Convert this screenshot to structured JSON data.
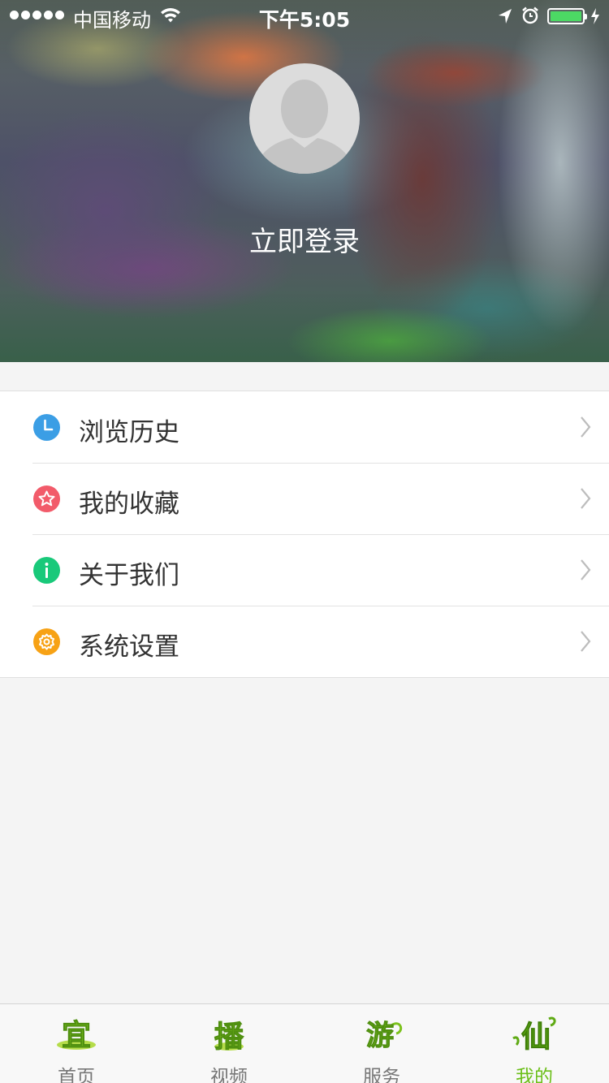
{
  "status_bar": {
    "carrier": "中国移动",
    "time": "下午5:05",
    "battery_level": 1.0
  },
  "profile": {
    "login_label": "立即登录"
  },
  "menu": [
    {
      "label": "浏览历史",
      "icon": "clock-icon",
      "color": "#3b9ee5"
    },
    {
      "label": "我的收藏",
      "icon": "star-icon",
      "color": "#f25b6a"
    },
    {
      "label": "关于我们",
      "icon": "info-icon",
      "color": "#19c97a"
    },
    {
      "label": "系统设置",
      "icon": "gear-icon",
      "color": "#f7a215"
    }
  ],
  "tabbar": {
    "active_color": "#6cbf1a",
    "items": [
      {
        "label": "首页",
        "glyph": "宜",
        "active": false
      },
      {
        "label": "视频",
        "glyph": "播",
        "active": false
      },
      {
        "label": "服务",
        "glyph": "游",
        "active": false
      },
      {
        "label": "我的",
        "glyph": "仙",
        "active": true
      }
    ]
  }
}
